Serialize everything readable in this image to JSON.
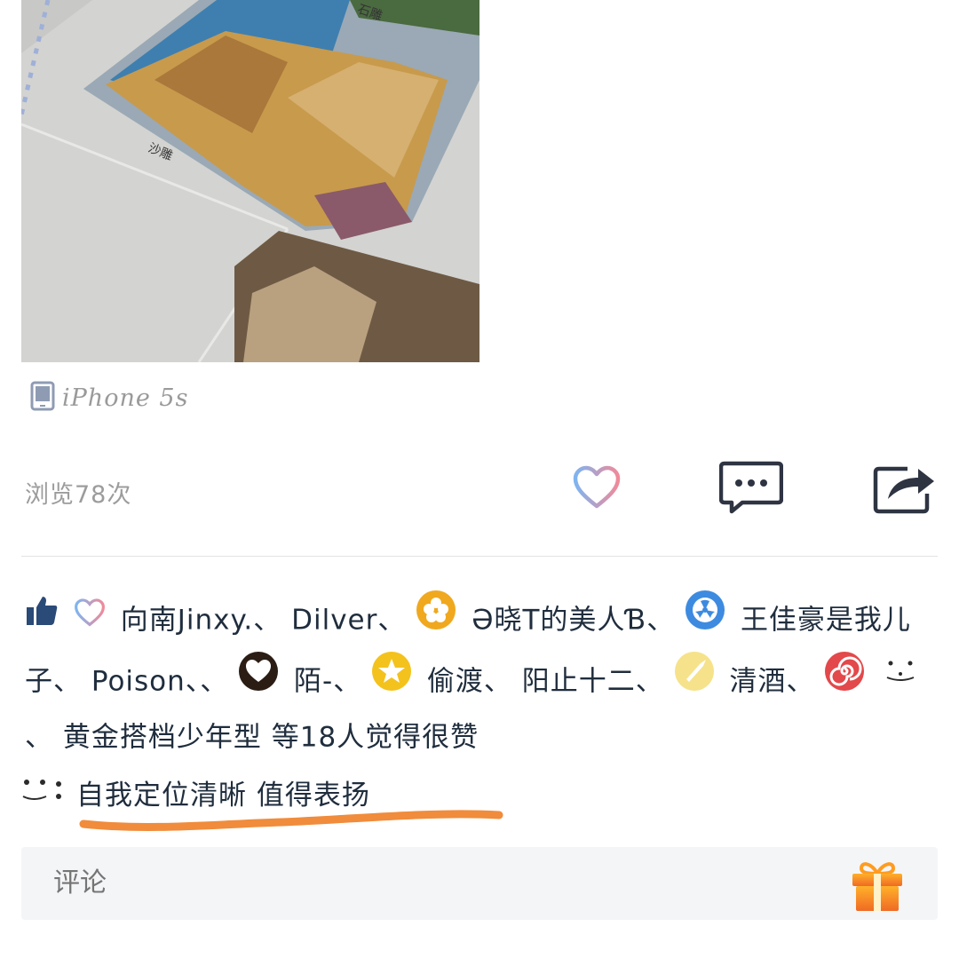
{
  "photo": {
    "caption_top": "石雕",
    "caption_middle": "沙雕"
  },
  "device": {
    "icon": "phone-icon",
    "label": "iPhone 5s"
  },
  "stats": {
    "views_text": "浏览78次"
  },
  "actions": {
    "like_icon": "heart-outline-icon",
    "comment_icon": "comment-bubble-icon",
    "share_icon": "share-arrow-icon"
  },
  "likes": {
    "thumb_icon": "thumb-up-icon",
    "names": [
      "向南Jinxy.、",
      "Dilver、",
      "Ə晓T的美人Ɓ、",
      "王佳豪是我儿子、",
      "Poison、、",
      "陌-、",
      "偷渡、",
      "阳止十二、",
      "清酒、",
      "、",
      "黄金搭档少年型"
    ],
    "summary": "等18人觉得很赞"
  },
  "comment": {
    "text": "自我定位清晰 值得表扬"
  },
  "comment_box": {
    "placeholder": "评论",
    "gift_icon": "gift-icon"
  },
  "colors": {
    "accent_blue": "#2f4f7a",
    "underline_orange": "#f08c3c",
    "heart_gradient_a": "#7fb4f0",
    "heart_gradient_b": "#f08a9a"
  }
}
